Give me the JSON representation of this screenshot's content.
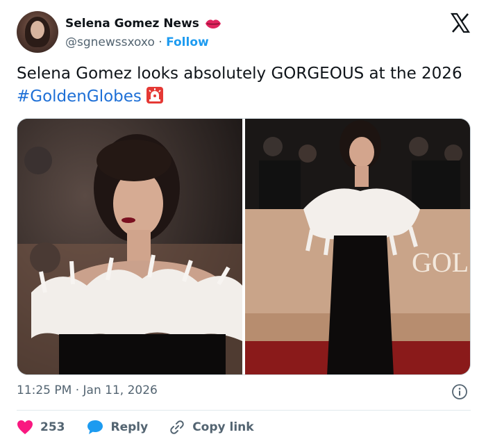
{
  "author": {
    "name": "Selena Gomez News",
    "handle": "@sgnewssxoxo",
    "separator": "·",
    "follow_label": "Follow",
    "name_emoji": "lips-icon"
  },
  "platform_logo": "x-logo-icon",
  "tweet": {
    "text_before": "Selena Gomez looks absolutely GORGEOUS at the 2026 ",
    "hashtag": "#GoldenGlobes",
    "emoji": "siren-icon"
  },
  "media": {
    "images": [
      {
        "name": "photo-closeup"
      },
      {
        "name": "photo-full-length",
        "backdrop_text": "GOL"
      }
    ]
  },
  "meta": {
    "time": "11:25 PM",
    "separator": "·",
    "date": "Jan 11, 2026"
  },
  "actions": {
    "like_count": "253",
    "reply_label": "Reply",
    "copy_label": "Copy link"
  },
  "colors": {
    "link": "#1d9bf0",
    "heart": "#f91880",
    "text_secondary": "#536471"
  }
}
